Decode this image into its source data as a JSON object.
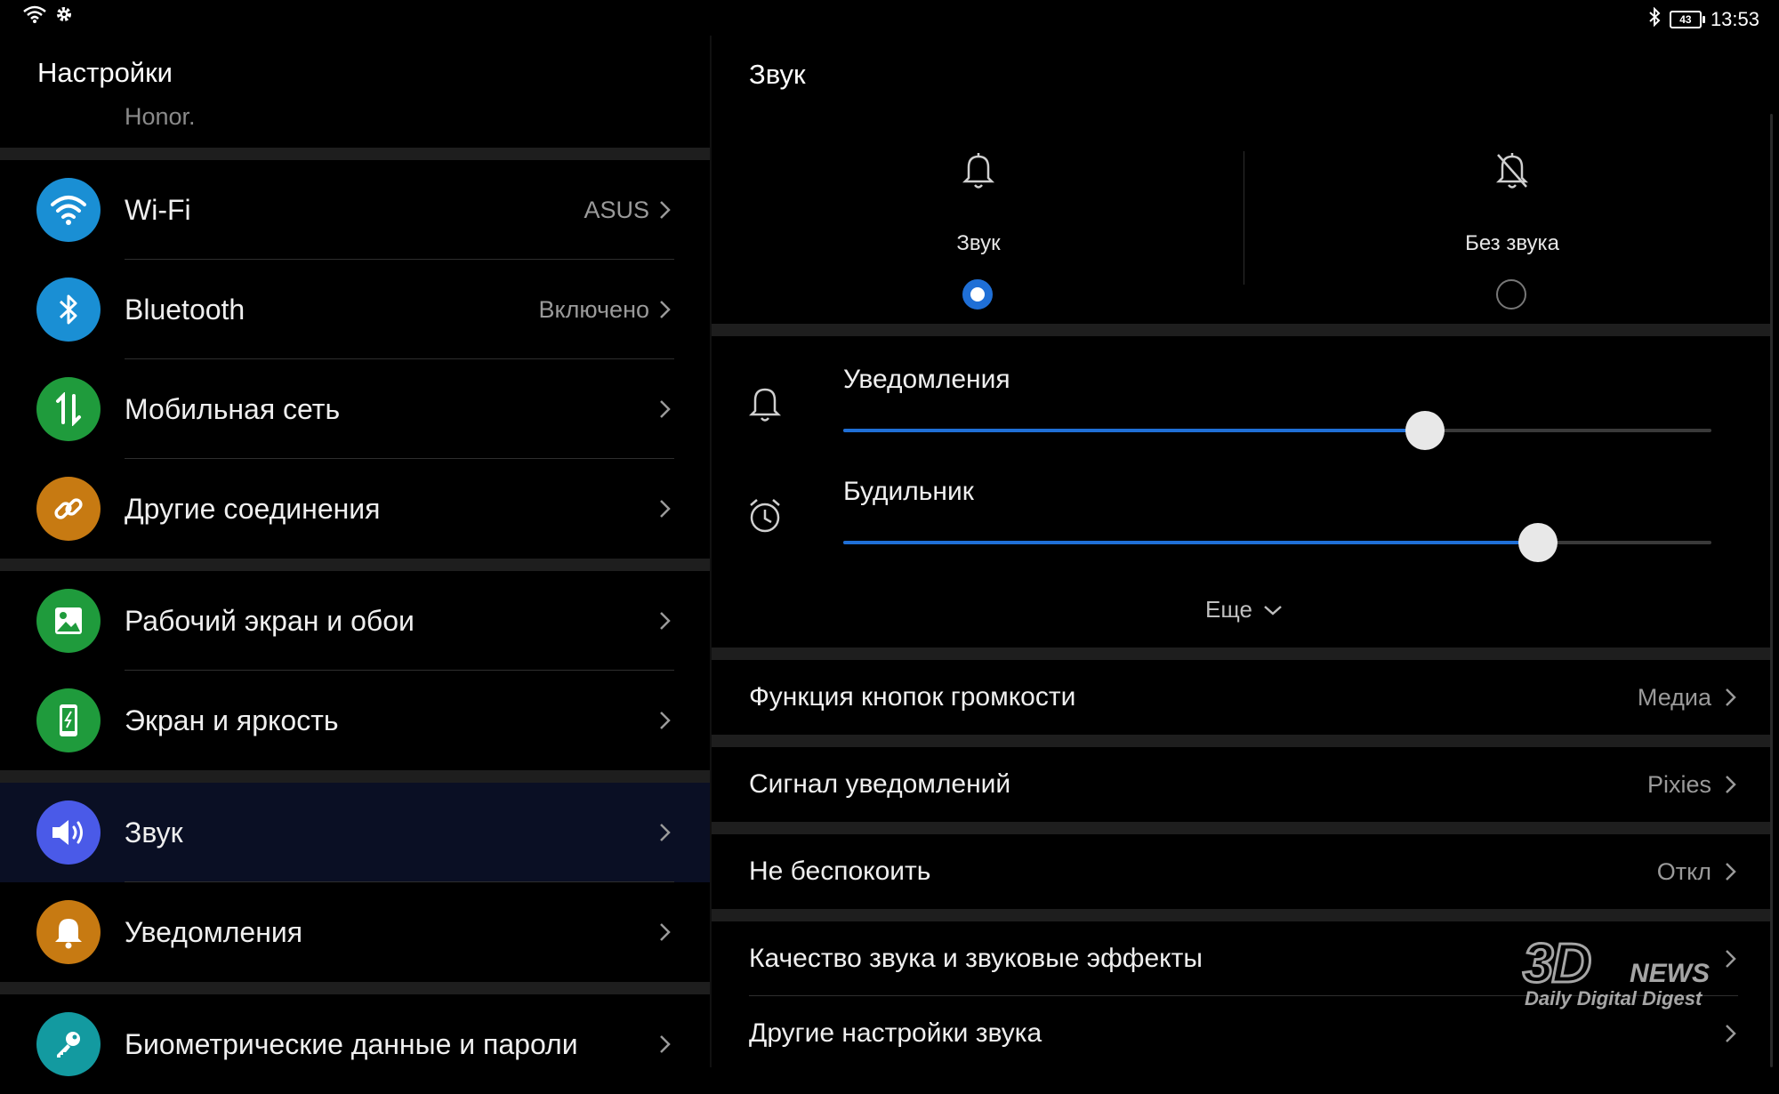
{
  "status_bar": {
    "time": "13:53",
    "battery": "43"
  },
  "left": {
    "title": "Настройки",
    "honor_text": "Honor.",
    "items": [
      {
        "label": "Wi-Fi",
        "value": "ASUS",
        "icon": "wifi-icon",
        "color": "#1a8fd4"
      },
      {
        "label": "Bluetooth",
        "value": "Включено",
        "icon": "bluetooth-icon",
        "color": "#1a8fd4"
      },
      {
        "label": "Мобильная сеть",
        "value": "",
        "icon": "mobile-data-icon",
        "color": "#1f9b3c"
      },
      {
        "label": "Другие соединения",
        "value": "",
        "icon": "link-icon",
        "color": "#c77a12"
      },
      {
        "label": "Рабочий экран и обои",
        "value": "",
        "icon": "wallpaper-icon",
        "color": "#1f9b3c"
      },
      {
        "label": "Экран и яркость",
        "value": "",
        "icon": "phone-display-icon",
        "color": "#1f9b3c"
      },
      {
        "label": "Звук",
        "value": "",
        "icon": "speaker-icon",
        "color": "#4a5ae8"
      },
      {
        "label": "Уведомления",
        "value": "",
        "icon": "bell-icon",
        "color": "#c77a12"
      },
      {
        "label": "Биометрические данные и пароли",
        "value": "",
        "icon": "key-icon",
        "color": "#139aa0"
      }
    ]
  },
  "right": {
    "title": "Звук",
    "modes": [
      {
        "label": "Звук",
        "selected": true
      },
      {
        "label": "Без звука",
        "selected": false
      }
    ],
    "volumes": [
      {
        "label": "Уведомления",
        "level": 0.67
      },
      {
        "label": "Будильник",
        "level": 0.8
      }
    ],
    "more": "Еще",
    "rows": [
      {
        "label": "Функция кнопок громкости",
        "value": "Медиа"
      },
      {
        "label": "Сигнал уведомлений",
        "value": "Pixies"
      },
      {
        "label": "Не беспокоить",
        "value": "Откл"
      },
      {
        "label": "Качество звука и звуковые эффекты",
        "value": ""
      },
      {
        "label": "Другие настройки звука",
        "value": ""
      }
    ]
  },
  "watermark": {
    "brand_big": "3D",
    "brand_small": "NEWS",
    "tagline": "Daily Digital Digest"
  },
  "colors": {
    "accent": "#1f6fd6",
    "background": "#000000",
    "separator": "#1e1e1e"
  }
}
